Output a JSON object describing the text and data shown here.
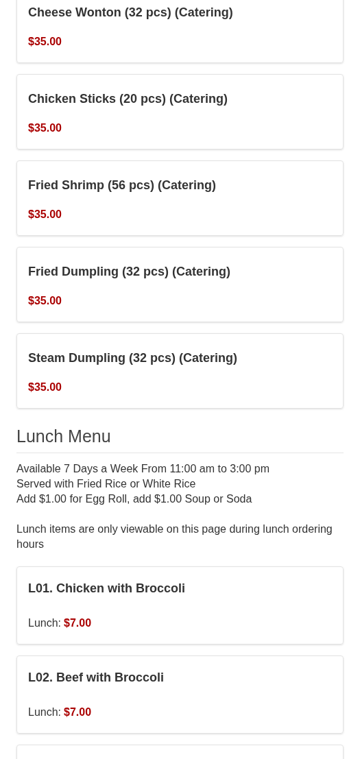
{
  "catering_items": [
    {
      "name": "Cheese Wonton (32 pcs) (Catering)",
      "price": "$35.00"
    },
    {
      "name": "Chicken Sticks (20 pcs) (Catering)",
      "price": "$35.00"
    },
    {
      "name": "Fried Shrimp (56 pcs) (Catering)",
      "price": "$35.00"
    },
    {
      "name": "Fried Dumpling (32 pcs) (Catering)",
      "price": "$35.00"
    },
    {
      "name": "Steam Dumpling (32 pcs) (Catering)",
      "price": "$35.00"
    }
  ],
  "lunch_menu": {
    "heading": "Lunch Menu",
    "description_lines": [
      "Available 7 Days a Week From 11:00 am to 3:00 pm",
      "Served with Fried Rice or White Rice",
      "Add $1.00 for Egg Roll, add $1.00 Soup or Soda"
    ],
    "note": "Lunch items are only viewable on this page during lunch ordering hours",
    "items": [
      {
        "name": "L01. Chicken with Broccoli",
        "price_label": "Lunch:",
        "price": "$7.00"
      },
      {
        "name": "L02. Beef with Broccoli",
        "price_label": "Lunch:",
        "price": "$7.00"
      }
    ]
  }
}
